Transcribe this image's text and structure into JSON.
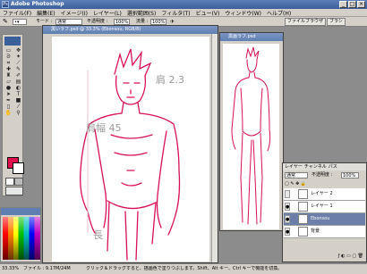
{
  "app": {
    "title": "Adobe Photoshop"
  },
  "menu": [
    "ファイル(F)",
    "編集(E)",
    "イメージ(I)",
    "レイヤー(L)",
    "選択範囲(S)",
    "フィルタ(T)",
    "ビュー(V)",
    "ウィンドウ(W)",
    "ヘルプ(H)"
  ],
  "options": {
    "mode_label": "モード :",
    "mode_value": "通常",
    "opacity_label": "不透明度 :",
    "opacity_value": "100%",
    "flow_label": "流量 :",
    "flow_value": "100%"
  },
  "palette_tabs": [
    "ファイルブラウザ",
    "ブラシ"
  ],
  "doc1": {
    "title": "黒いラフ.psd @ 33.3% (Ebonsou, RGB/8)"
  },
  "doc2": {
    "title": "黒画ラフ.psd"
  },
  "sketch_texts": {
    "t1": "肩 2.3",
    "t2": "肩幅 45",
    "t3": "長"
  },
  "layers": {
    "tabs": [
      "レイヤー",
      "チャンネル",
      "パス"
    ],
    "blend": "通常",
    "opacity_label": "不透明度 :",
    "opacity_value": "100%",
    "items": [
      {
        "name": "レイヤー 2",
        "visible": false,
        "selected": false
      },
      {
        "name": "レイヤー 1",
        "visible": true,
        "selected": false
      },
      {
        "name": "Ebonsou",
        "visible": true,
        "selected": true
      },
      {
        "name": "背景",
        "visible": true,
        "selected": false
      }
    ]
  },
  "status": {
    "zoom": "33.33%",
    "file": "ファイル : 9.17M/24M",
    "hint": "クリック＆ドラッグすると、描画色で塗りつぶします。Shift、Alt キー、Ctrl キーで機能を切換。"
  },
  "colors": {
    "foreground": "#e0114f",
    "background": "#ffffff",
    "sketch": "#d8105a"
  }
}
